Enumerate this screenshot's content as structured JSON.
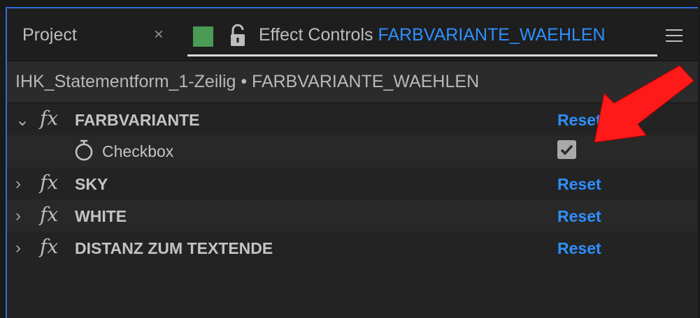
{
  "tabs": {
    "project_label": "Project",
    "close_glyph": "×",
    "effect_controls_label": "Effect Controls",
    "effect_controls_comp": "FARBVARIANTE_WAEHLEN"
  },
  "breadcrumb": {
    "text": "IHK_Statementform_1-Zeilig • FARBVARIANTE_WAEHLEN"
  },
  "effects": [
    {
      "name": "FARBVARIANTE",
      "expanded": true,
      "reset_label": "Reset",
      "params": [
        {
          "name": "Checkbox",
          "checked": true
        }
      ]
    },
    {
      "name": "SKY",
      "expanded": false,
      "reset_label": "Reset"
    },
    {
      "name": "WHITE",
      "expanded": false,
      "reset_label": "Reset"
    },
    {
      "name": "DISTANZ ZUM TEXTENDE",
      "expanded": false,
      "reset_label": "Reset"
    }
  ],
  "glyphs": {
    "chevron_down": "⌄",
    "chevron_right": "›",
    "fx": "fx"
  },
  "colors": {
    "accent_blue": "#2f8fff",
    "label_swatch": "#4a9b55",
    "annotation_arrow": "#ff0000",
    "panel_border": "#2f6fd6"
  },
  "icons": [
    "lock-icon",
    "menu-icon",
    "stopwatch-icon",
    "checkbox-checked-icon",
    "red-annotation-arrow"
  ]
}
